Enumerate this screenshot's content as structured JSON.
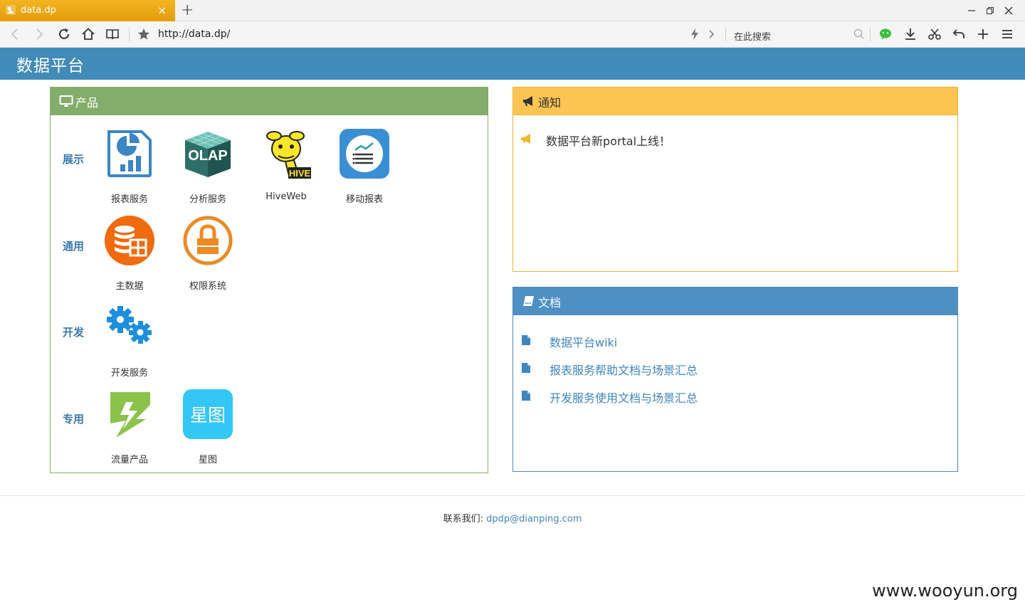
{
  "browser": {
    "tab_title": "data.dp",
    "url": "http://data.dp/",
    "search_placeholder": "在此搜索"
  },
  "header": {
    "brand": "数据平台"
  },
  "products": {
    "title": "产品",
    "rows": [
      {
        "label": "展示",
        "items": [
          "报表服务",
          "分析服务",
          "HiveWeb",
          "移动报表"
        ]
      },
      {
        "label": "通用",
        "items": [
          "主数据",
          "权限系统"
        ]
      },
      {
        "label": "开发",
        "items": [
          "开发服务"
        ]
      },
      {
        "label": "专用",
        "items": [
          "流量产品",
          "星图"
        ]
      }
    ],
    "olap_text": "OLAP",
    "hive_text": "HIVE",
    "xingtu_text": "星图"
  },
  "notice": {
    "title": "通知",
    "items": [
      "数据平台新portal上线！"
    ]
  },
  "docs": {
    "title": "文档",
    "links": [
      "数据平台wiki",
      "报表服务帮助文档与场景汇总",
      "开发服务使用文档与场景汇总"
    ]
  },
  "footer": {
    "label": "联系我们: ",
    "email": "dpdp@dianping.com"
  },
  "watermark": "www.wooyun.org"
}
